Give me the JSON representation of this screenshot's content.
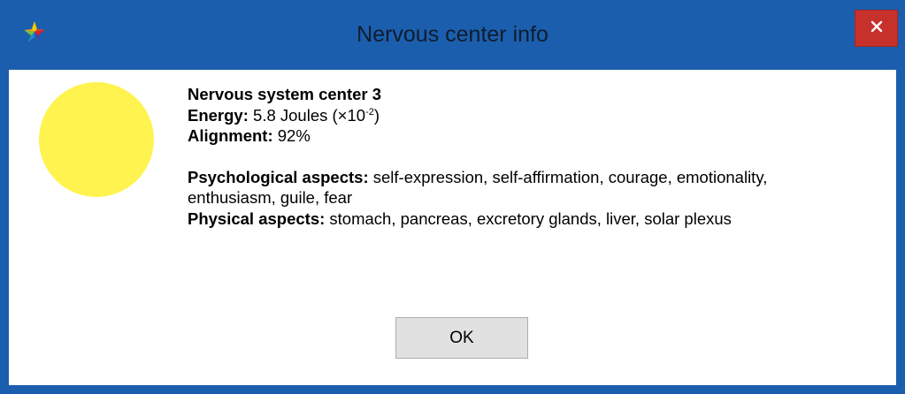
{
  "window": {
    "title": "Nervous center info",
    "close_icon": "close-icon",
    "app_icon": "colorful-star-app-icon"
  },
  "center": {
    "indicator_color": "#fff350",
    "name": "Nervous system center 3",
    "energy_label": "Energy:",
    "energy_value": "5.8 Joules (×10",
    "energy_exponent": "-2",
    "energy_suffix": ")",
    "alignment_label": "Alignment:",
    "alignment_value": "92%",
    "psych_label": "Psychological aspects:",
    "psych_value": "self-expression, self-affirmation, courage, emotionality, enthusiasm, guile, fear",
    "physical_label": "Physical aspects:",
    "physical_value": "stomach, pancreas, excretory glands, liver, solar plexus"
  },
  "buttons": {
    "ok_label": "OK"
  },
  "colors": {
    "titlebar": "#1b5ead",
    "close_button": "#c7312c",
    "client_background": "#ffffff"
  }
}
